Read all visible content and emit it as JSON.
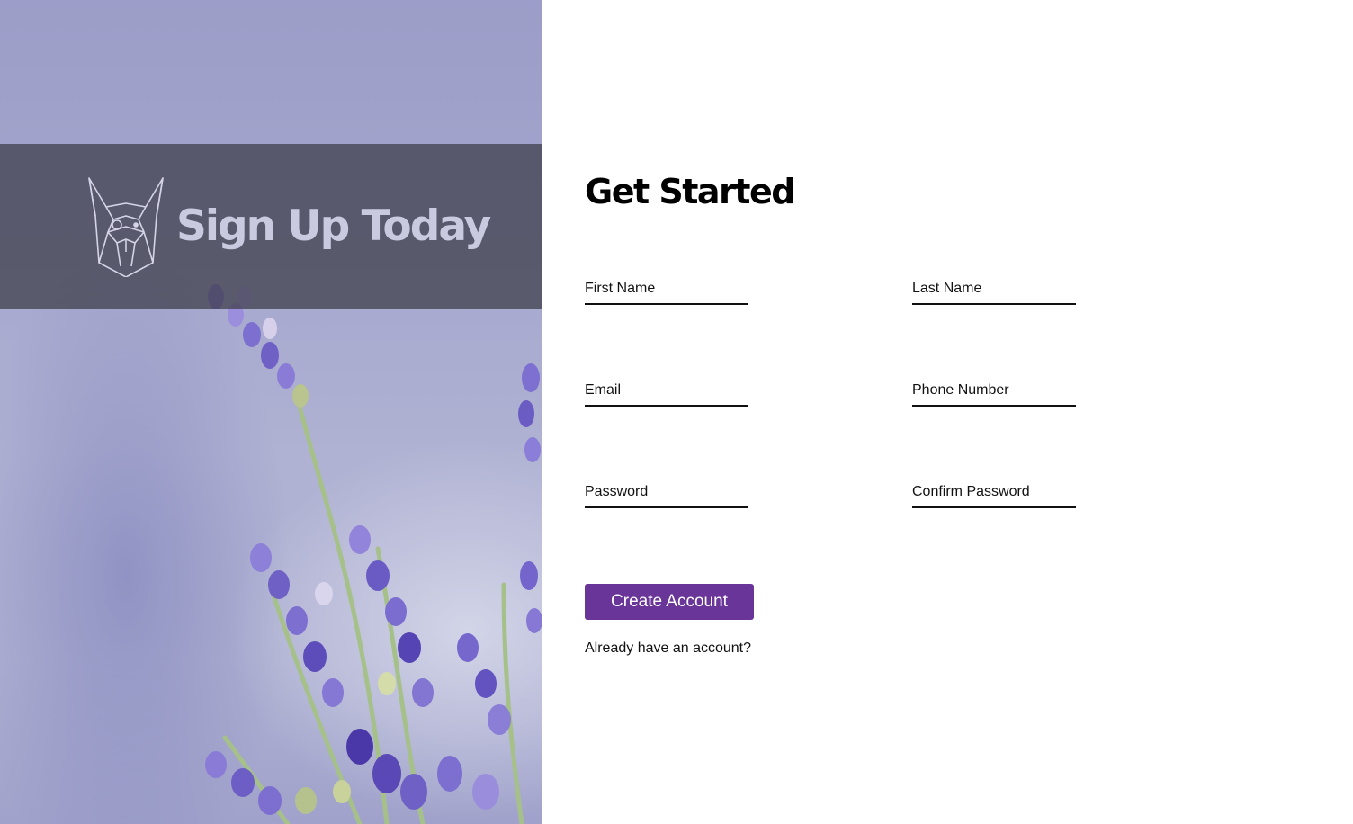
{
  "hero": {
    "title": "Sign Up Today",
    "logo_icon": "boston-terrier-dog-logo-icon",
    "background": "lavender-flowers-photo"
  },
  "form": {
    "title": "Get Started",
    "fields": {
      "first_name": {
        "placeholder": "First Name",
        "value": ""
      },
      "last_name": {
        "placeholder": "Last Name",
        "value": ""
      },
      "email": {
        "placeholder": "Email",
        "value": ""
      },
      "phone": {
        "placeholder": "Phone Number",
        "value": ""
      },
      "password": {
        "placeholder": "Password",
        "value": ""
      },
      "confirm_password": {
        "placeholder": "Confirm Password",
        "value": ""
      }
    },
    "submit_label": "Create Account",
    "signin_link": "Already have an account?"
  },
  "colors": {
    "accent": "#6a3598",
    "text": "#111111",
    "band_overlay": "#3c3c46",
    "hero_title": "#c9c9df"
  }
}
